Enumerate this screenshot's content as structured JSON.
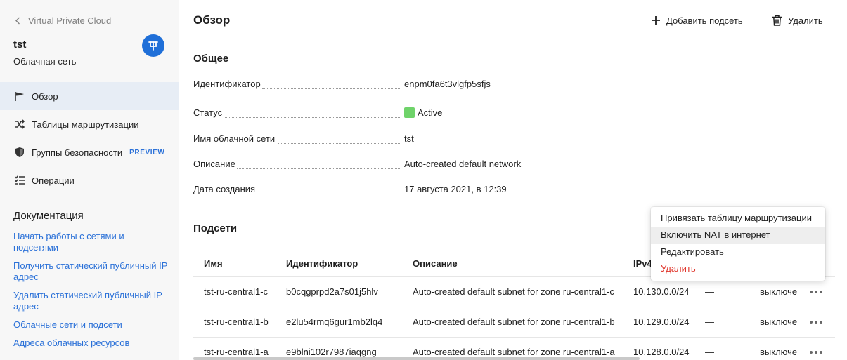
{
  "sidebar": {
    "back_label": "Virtual Private Cloud",
    "network_name": "tst",
    "network_type": "Облачная сеть",
    "nav": [
      {
        "label": "Обзор",
        "active": true,
        "icon": "flag-icon"
      },
      {
        "label": "Таблицы маршрутизации",
        "active": false,
        "icon": "routing-icon"
      },
      {
        "label": "Группы безопасности",
        "active": false,
        "icon": "shield-icon",
        "badge": "PREVIEW"
      },
      {
        "label": "Операции",
        "active": false,
        "icon": "operations-list-icon"
      }
    ],
    "docs_title": "Документация",
    "docs": [
      "Начать работы с сетями и подсетями",
      "Получить статический публичный IP адрес",
      "Удалить статический публичный IP адрес",
      "Облачные сети и подсети",
      "Адреса облачных ресурсов"
    ]
  },
  "header": {
    "title": "Обзор",
    "add_subnet": "Добавить подсеть",
    "delete": "Удалить"
  },
  "general": {
    "title": "Общее",
    "fields": {
      "id": {
        "label": "Идентификатор",
        "value": "enpm0fa6t3vlgfp5sfjs"
      },
      "status": {
        "label": "Статус",
        "value": "Active"
      },
      "name": {
        "label": "Имя облачной сети",
        "value": "tst"
      },
      "description": {
        "label": "Описание",
        "value": "Auto-created default network"
      },
      "created": {
        "label": "Дата создания",
        "value": "17 августа 2021, в 12:39"
      }
    }
  },
  "subnets": {
    "title": "Подсети",
    "columns": {
      "name": "Имя",
      "id": "Идентификатор",
      "description": "Описание",
      "ipv4": "IPv4"
    },
    "rows": [
      {
        "name": "tst-ru-central1-c",
        "id": "b0cqgprpd2a7s01j5hlv",
        "description": "Auto-created default subnet for zone ru-central1-c",
        "ipv4": "10.130.0.0/24",
        "dash": "—",
        "nat": "выключе"
      },
      {
        "name": "tst-ru-central1-b",
        "id": "e2lu54rmq6gur1mb2lq4",
        "description": "Auto-created default subnet for zone ru-central1-b",
        "ipv4": "10.129.0.0/24",
        "dash": "—",
        "nat": "выключе"
      },
      {
        "name": "tst-ru-central1-a",
        "id": "e9blni102r7987iaqgng",
        "description": "Auto-created default subnet for zone ru-central1-a",
        "ipv4": "10.128.0.0/24",
        "dash": "—",
        "nat": "выключе"
      }
    ]
  },
  "context_menu": {
    "items": [
      {
        "label": "Привязать таблицу маршрутизации"
      },
      {
        "label": "Включить NAT в интернет"
      },
      {
        "label": "Редактировать"
      },
      {
        "label": "Удалить"
      }
    ]
  },
  "colors": {
    "accent": "#2b71d8",
    "status_active": "#6fd36a",
    "danger": "#e0362c"
  }
}
